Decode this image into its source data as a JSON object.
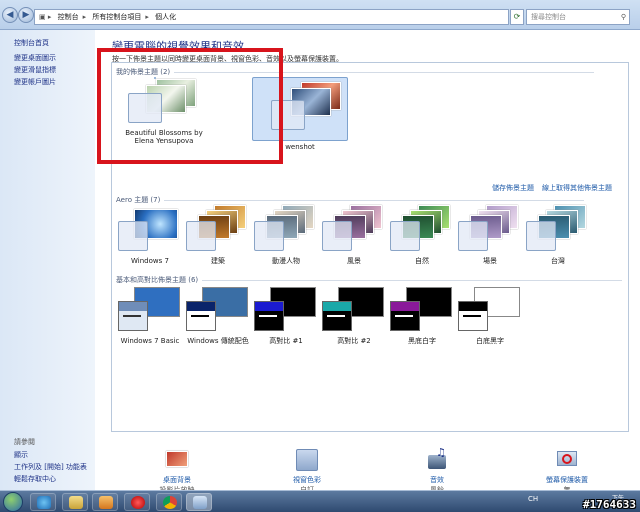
{
  "address": {
    "crumbs": [
      "控制台",
      "所有控制台項目",
      "個人化"
    ],
    "search_placeholder": "搜尋控制台"
  },
  "sidebar": {
    "items": [
      "控制台首頁",
      "變更桌面圖示",
      "變更滑鼠指標",
      "變更帳戶圖片"
    ],
    "see_also_title": "請參閱",
    "see_also": [
      "顯示",
      "工作列及 [開始] 功能表",
      "輕鬆存取中心"
    ]
  },
  "main": {
    "title": "變更電腦的視覺效果和音效",
    "subtitle": "按一下佈景主題以同時變更桌面背景、視窗色彩、音效以及螢幕保護裝置。",
    "my_themes_header": "我的佈景主題 (2)",
    "my_themes": [
      "Beautiful Blossoms by Elena Yensupova",
      "wenshot"
    ],
    "save_theme_link": "儲存佈景主題",
    "online_link": "線上取得其他佈景主題",
    "aero_header": "Aero 主題 (7)",
    "aero_themes": [
      "Windows 7",
      "建築",
      "動漫人物",
      "風景",
      "自然",
      "場景",
      "台灣"
    ],
    "basic_header": "基本和高對比佈景主題 (6)",
    "basic_themes": [
      "Windows 7 Basic",
      "Windows 傳統配色",
      "高對比 #1",
      "高對比 #2",
      "黑底白字",
      "白底黑字"
    ]
  },
  "bottom": [
    {
      "title": "桌面背景",
      "sub": "投影片放映"
    },
    {
      "title": "視窗色彩",
      "sub": "自訂"
    },
    {
      "title": "音效",
      "sub": "風鈴"
    },
    {
      "title": "螢幕保護裝置",
      "sub": "無"
    }
  ],
  "taskbar": {
    "tray": "CH",
    "clock": "下午 04:00"
  },
  "watermark": "#1764633",
  "colors": {
    "highlight": "#d8141c",
    "link": "#1e5aa8",
    "selected": "#cfe1f8"
  }
}
